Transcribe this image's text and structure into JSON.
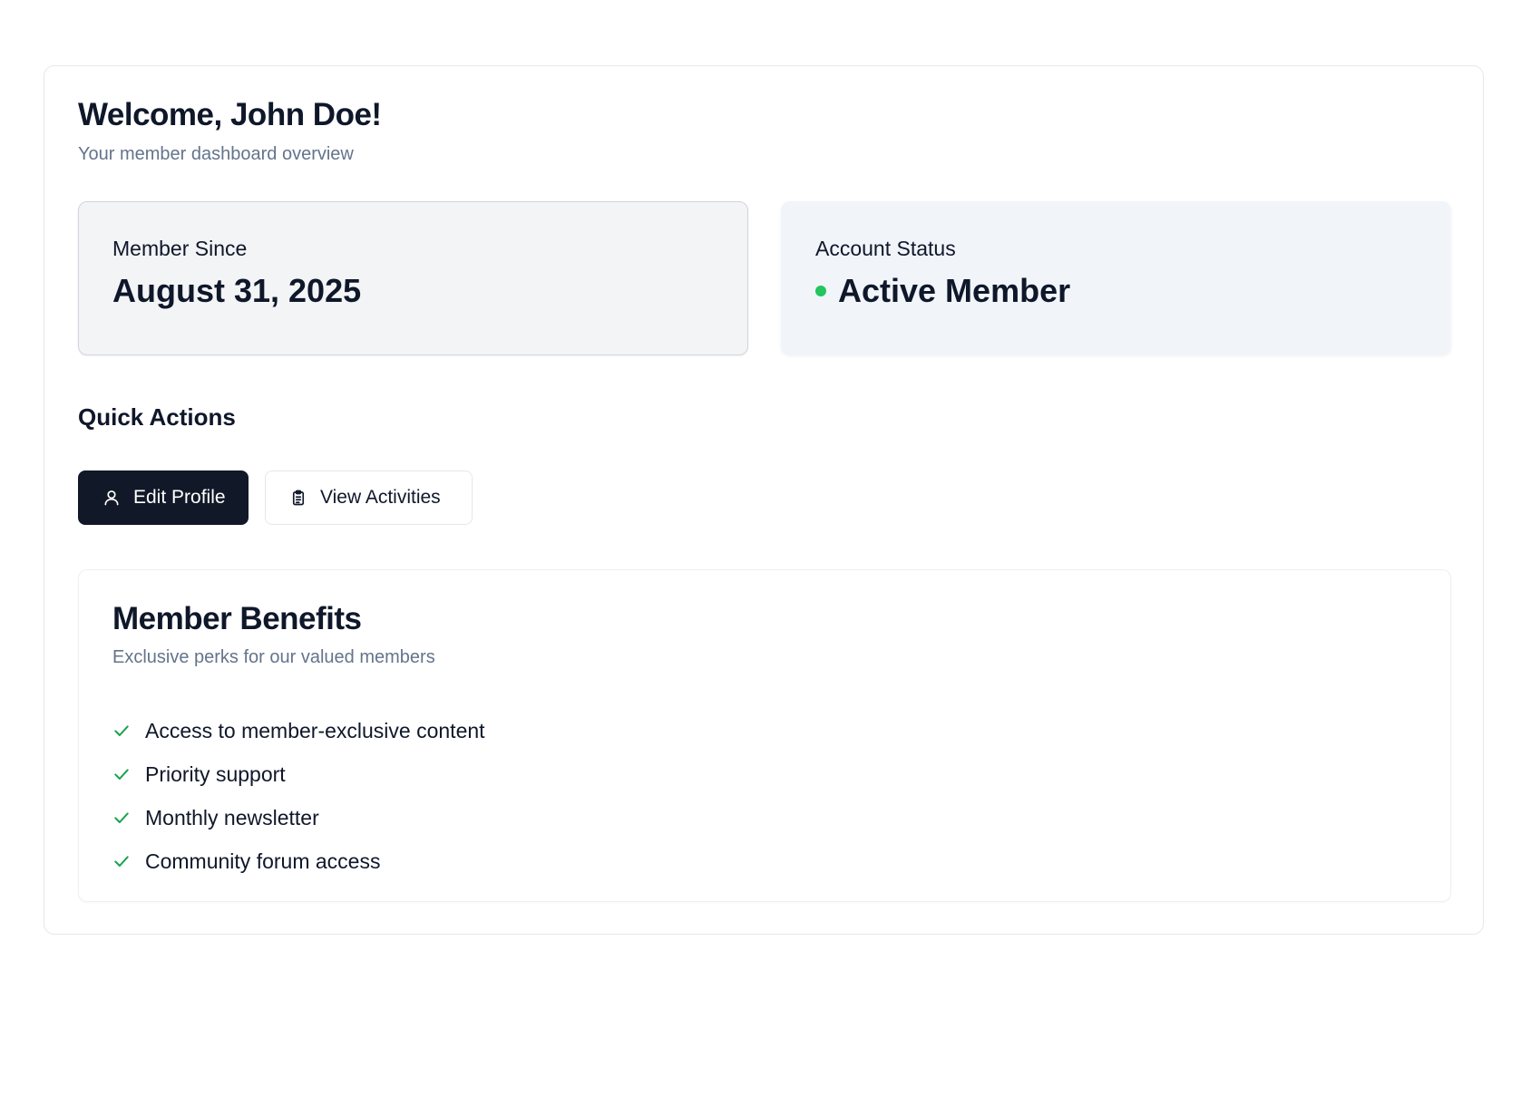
{
  "header": {
    "title": "Welcome, John Doe!",
    "subtitle": "Your member dashboard overview"
  },
  "stats": {
    "member_since": {
      "label": "Member Since",
      "value": "August 31, 2025"
    },
    "account_status": {
      "label": "Account Status",
      "value": "Active Member",
      "status_color": "#22c55e"
    }
  },
  "quick_actions": {
    "title": "Quick Actions",
    "buttons": [
      {
        "label": "Edit Profile",
        "icon": "user-icon",
        "style": "primary"
      },
      {
        "label": "View Activities",
        "icon": "clipboard-icon",
        "style": "secondary"
      }
    ]
  },
  "benefits": {
    "title": "Member Benefits",
    "subtitle": "Exclusive perks for our valued members",
    "check_color": "#16a34a",
    "items": [
      "Access to member-exclusive content",
      "Priority support",
      "Monthly newsletter",
      "Community forum access"
    ]
  },
  "colors": {
    "primary_button": "#111827",
    "muted_text": "#64748b",
    "text": "#0f172a"
  }
}
